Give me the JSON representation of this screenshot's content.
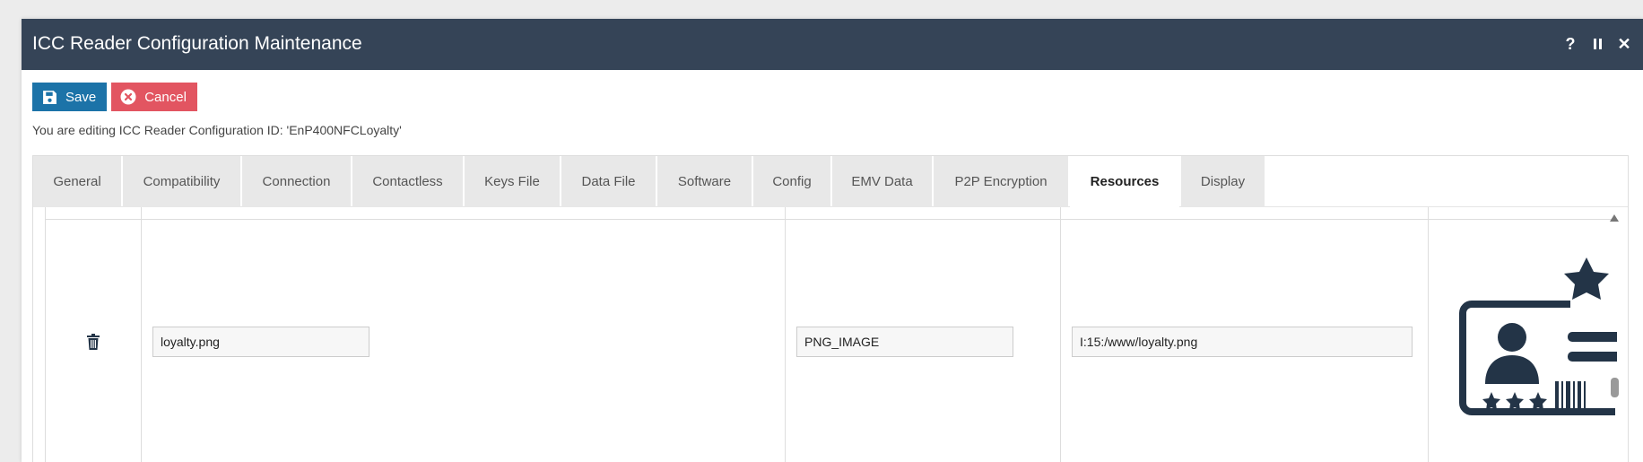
{
  "dialog": {
    "title": "ICC Reader Configuration Maintenance",
    "help_icon_label": "?",
    "close_icon_label": "✕"
  },
  "toolbar": {
    "save_label": "Save",
    "cancel_label": "Cancel"
  },
  "editing_text": "You are editing ICC Reader Configuration ID: 'EnP400NFCLoyalty'",
  "tabs": [
    {
      "label": "General"
    },
    {
      "label": "Compatibility"
    },
    {
      "label": "Connection"
    },
    {
      "label": "Contactless"
    },
    {
      "label": "Keys File"
    },
    {
      "label": "Data File"
    },
    {
      "label": "Software"
    },
    {
      "label": "Config"
    },
    {
      "label": "EMV Data"
    },
    {
      "label": "P2P Encryption"
    },
    {
      "label": "Resources",
      "active": true
    },
    {
      "label": "Display"
    }
  ],
  "resources": {
    "rows": [
      {
        "file_name": "loyalty.png",
        "resource_type": "PNG_IMAGE",
        "path": "I:15:/www/loyalty.png",
        "image_icon": "loyalty-card-icon"
      }
    ]
  },
  "colors": {
    "titlebar": "#354457",
    "save_button": "#1c73a8",
    "cancel_button": "#e25561",
    "icon_dark": "#233447"
  }
}
